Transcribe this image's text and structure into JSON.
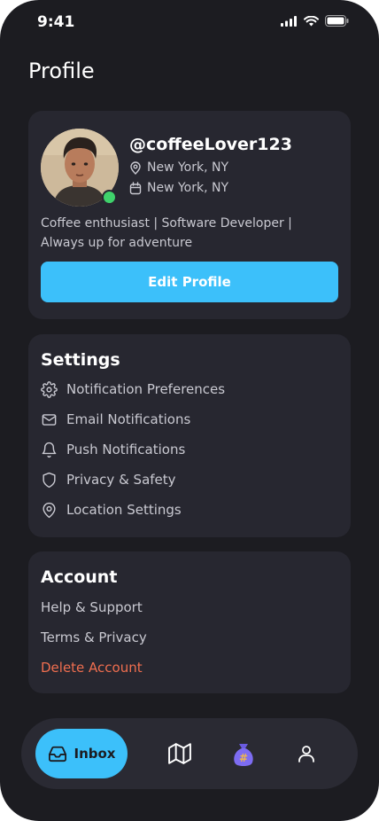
{
  "status_bar": {
    "time": "9:41"
  },
  "page": {
    "title": "Profile"
  },
  "profile": {
    "username": "@coffeeLover123",
    "location": "New York, NY",
    "joined": "New York, NY",
    "bio": "Coffee enthusiast | Software Developer | Always up for adventure",
    "edit_label": "Edit Profile",
    "online": true
  },
  "settings": {
    "title": "Settings",
    "items": [
      {
        "label": "Notification Preferences",
        "icon": "gear-icon"
      },
      {
        "label": "Email Notifications",
        "icon": "mail-icon"
      },
      {
        "label": "Push Notifications",
        "icon": "bell-icon"
      },
      {
        "label": "Privacy & Safety",
        "icon": "shield-icon"
      },
      {
        "label": "Location Settings",
        "icon": "map-pin-icon"
      }
    ]
  },
  "account": {
    "title": "Account",
    "items": [
      {
        "label": "Help & Support"
      },
      {
        "label": "Terms & Privacy"
      },
      {
        "label": "Delete Account"
      }
    ]
  },
  "tabbar": {
    "inbox_label": "Inbox",
    "tabs": [
      "inbox-icon",
      "map-icon",
      "hashtag-bag-icon",
      "user-icon"
    ]
  },
  "colors": {
    "background": "#1c1c21",
    "card": "#272730",
    "accent": "#3cc0fa",
    "danger": "#ef6e4f",
    "online": "#3fd26b",
    "bag_purple": "#7d6cf2"
  }
}
